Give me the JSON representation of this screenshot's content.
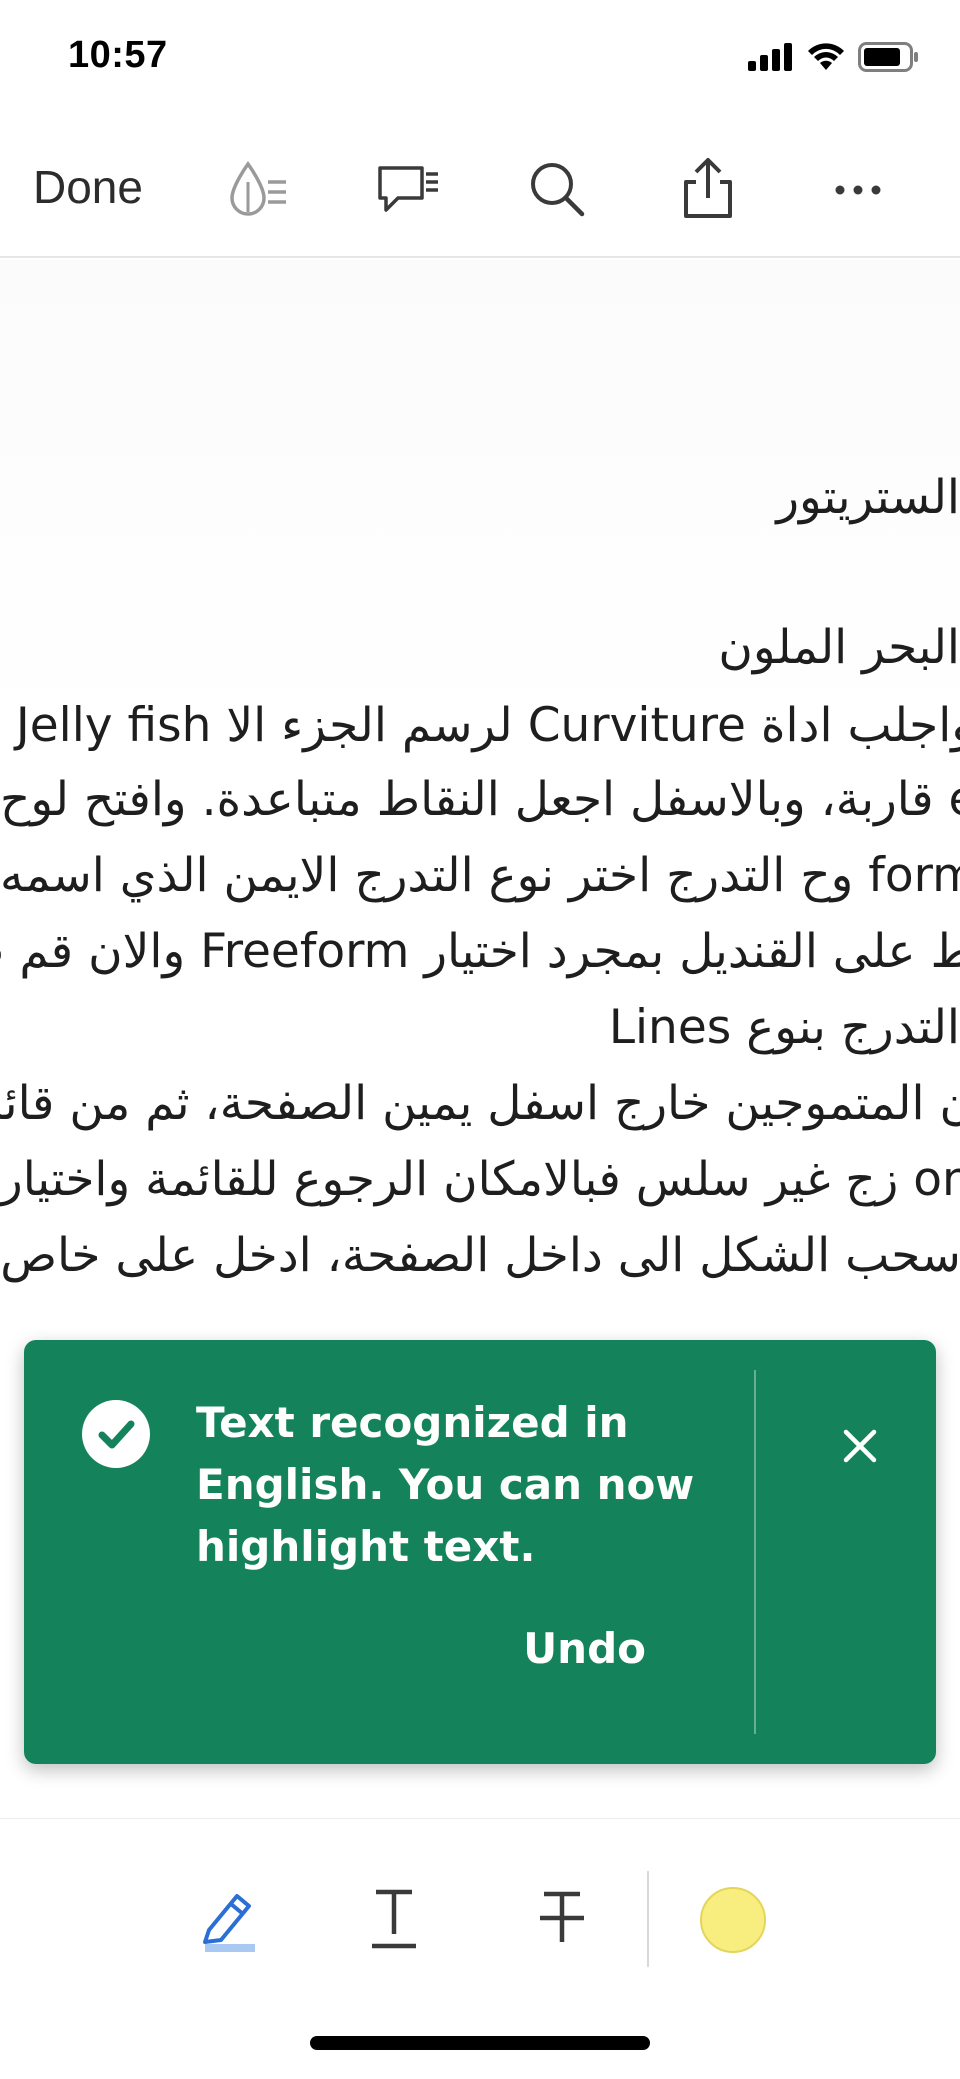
{
  "status_bar": {
    "time": "10:57"
  },
  "toolbar": {
    "done_label": "Done",
    "icons": [
      "ink-drop-icon",
      "comment-list-icon",
      "search-icon",
      "share-icon",
      "more-icon"
    ]
  },
  "document": {
    "lines": [
      "الستريتور",
      "البحر الملون",
      "واجلب اداة Curviture لرسم الجزء الا Jelly fish .",
      "قاربة، وبالاسفل اجعل النقاط متباعدة. وافتح لوح ent",
      "وح التدرج اختر نوع التدرج الايمن الذي اسمه form",
      "ط على القنديل بمجرد اختيار Freeform والان قم ب",
      "التدرج بنوع Lines",
      "ن المتموجين خارج اسفل يمين الصفحة، ثم من قائمة",
      "زج غير سلس فبالامكان الرجوع للقائمة واختيار ons",
      "اسحب الشكل الى داخل الصفحة، ادخل على خاص"
    ]
  },
  "toast": {
    "message": "Text recognized in English. You can now highlight text.",
    "undo_label": "Undo"
  },
  "bottom_tools": {
    "tools": [
      "highlight-tool-icon",
      "underline-tool-icon",
      "strikethrough-tool-icon"
    ],
    "active_color": "#f8ee80",
    "accent": "#2b6fd6"
  },
  "colors": {
    "toast_bg": "#14835c"
  }
}
